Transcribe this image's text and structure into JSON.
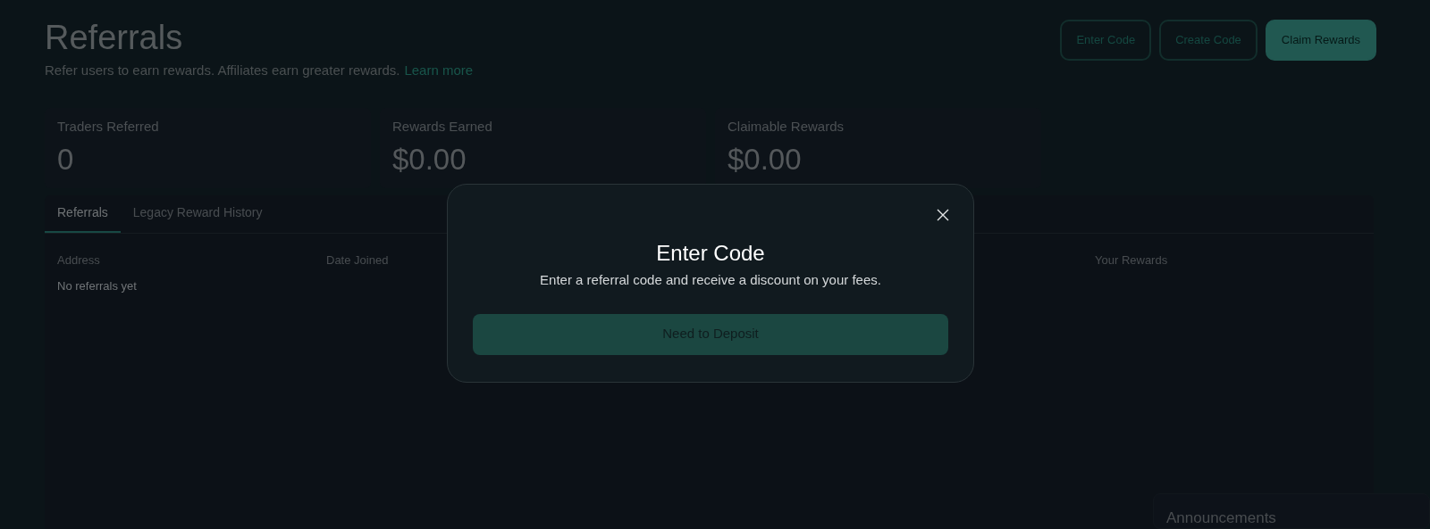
{
  "page": {
    "title": "Referrals",
    "subtitle": "Refer users to earn rewards. Affiliates earn greater rewards.",
    "learn_more_link": "Learn more"
  },
  "header_buttons": [
    {
      "label": "Enter Code",
      "kind": "outline"
    },
    {
      "label": "Create Code",
      "kind": "outline"
    },
    {
      "label": "Claim Rewards",
      "kind": "primary"
    }
  ],
  "stats": [
    {
      "label": "Traders Referred",
      "value": "0"
    },
    {
      "label": "Rewards Earned",
      "value": "$0.00"
    },
    {
      "label": "Claimable Rewards",
      "value": "$0.00"
    }
  ],
  "tabs": [
    {
      "label": "Referrals",
      "selected": true
    },
    {
      "label": "Legacy Reward History",
      "selected": false
    }
  ],
  "table": {
    "columns": [
      "Address",
      "Date Joined",
      "Your Rewards"
    ],
    "empty_message": "No referrals yet"
  },
  "announcements": {
    "title": "Announcements"
  },
  "modal": {
    "title": "Enter Code",
    "description": "Enter a referral code and receive a discount on your fees.",
    "button": "Need to Deposit"
  }
}
